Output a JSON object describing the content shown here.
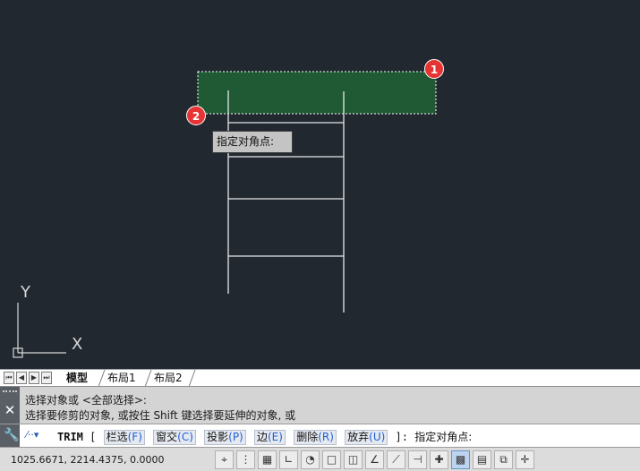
{
  "canvas": {
    "tooltip": "指定对角点:",
    "badge_1": "1",
    "badge_2": "2",
    "axis_y": "Y",
    "axis_x": "X"
  },
  "tabs": {
    "nav": [
      "⏮",
      "◀",
      "▶",
      "⏭"
    ],
    "items": [
      "模型",
      "布局1",
      "布局2"
    ]
  },
  "history": {
    "line1": "选择对象或 <全部选择>:",
    "line2": "选择要修剪的对象, 或按住 Shift 键选择要延伸的对象, 或"
  },
  "commandline": {
    "command": "TRIM",
    "open_bracket": "[",
    "options": [
      {
        "label": "栏选",
        "key": "(F)"
      },
      {
        "label": "窗交",
        "key": "(C)"
      },
      {
        "label": "投影",
        "key": "(P)"
      },
      {
        "label": "边",
        "key": "(E)"
      },
      {
        "label": "删除",
        "key": "(R)"
      },
      {
        "label": "放弃",
        "key": "(U)"
      }
    ],
    "close_bracket": "]:",
    "prompt": "指定对角点:"
  },
  "status": {
    "coords": "1025.6671, 2214.4375, 0.0000"
  },
  "colors": {
    "canvas_bg": "#212830",
    "selection_fill": "#1f5a34",
    "badge": "#e63434"
  }
}
